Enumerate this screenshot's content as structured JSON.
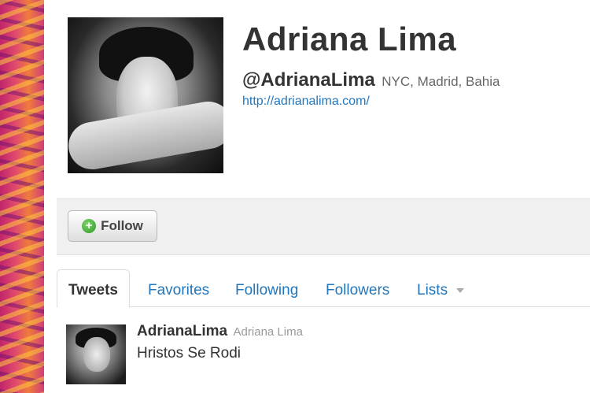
{
  "profile": {
    "name": "Adriana Lima",
    "screen_name": "@AdrianaLima",
    "location": "NYC, Madrid, Bahia",
    "url": "http://adrianalima.com/"
  },
  "follow_bar": {
    "follow_label": "Follow",
    "follow_icon": "plus-circle-icon"
  },
  "tabs": [
    {
      "label": "Tweets",
      "active": true
    },
    {
      "label": "Favorites",
      "active": false
    },
    {
      "label": "Following",
      "active": false
    },
    {
      "label": "Followers",
      "active": false
    },
    {
      "label": "Lists",
      "active": false
    }
  ],
  "tweet": {
    "screen_name": "AdrianaLima",
    "full_name": "Adriana Lima",
    "text": "Hristos Se Rodi"
  },
  "colors": {
    "link": "#2276bb",
    "text": "#333333",
    "muted": "#999999",
    "follow_bar_bg": "#f0f0f0"
  }
}
